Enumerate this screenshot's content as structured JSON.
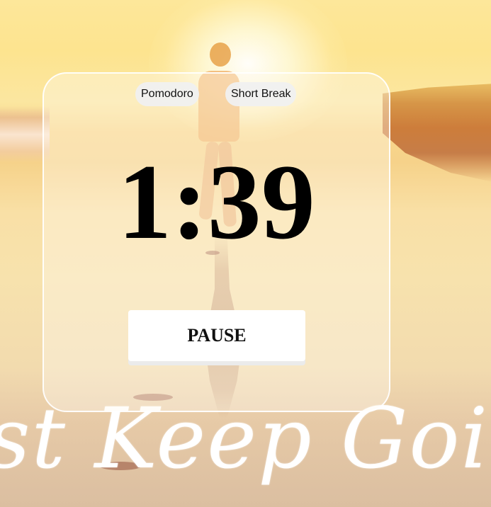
{
  "tabs": {
    "pomodoro": "Pomodoro",
    "short_break": "Short Break"
  },
  "timer": {
    "display": "1:39"
  },
  "controls": {
    "pause_label": "PAUSE"
  },
  "background": {
    "quote": "st Keep Goin"
  },
  "colors": {
    "card_border": "#ffffff",
    "button_bg": "#ffffff",
    "tab_bg": "#f0f0f0",
    "text": "#000000"
  }
}
